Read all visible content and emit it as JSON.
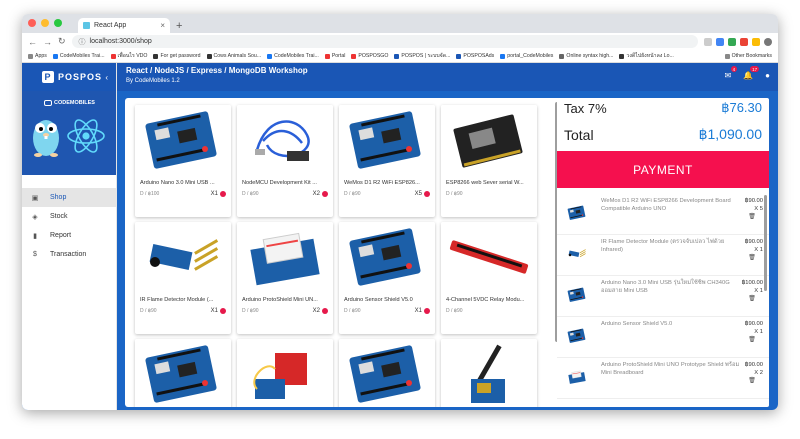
{
  "browser": {
    "tab_title": "React App",
    "url": "localhost:3000/shop",
    "bookmarks": [
      "Apps",
      "CodeMobiles Trai...",
      "เพื่อนไร VDO",
      "For get password",
      "Cows Animals Sou...",
      "CodeMobiles Trai...",
      "Portal",
      "POSPOSGO",
      "POSPOS | ระบบจัด...",
      "POSPOSAds",
      "portal_CodeMobiles",
      "Online syntax high...",
      "วงดีไปยังหน้าลง Lo..."
    ],
    "other_bookmarks": "Other Bookmarks"
  },
  "brand": {
    "name": "POSPOS",
    "logo_letter": "P",
    "company": "CODEMOBILES"
  },
  "header": {
    "title": "React / NodeJS / Express / MongoDB Workshop",
    "subtitle": "By CodeMobiles 1.2",
    "mail_badge": "4",
    "notif_badge": "17"
  },
  "nav": [
    {
      "label": "Shop",
      "icon": "shop-icon",
      "active": true
    },
    {
      "label": "Stock",
      "icon": "layers-icon",
      "active": false
    },
    {
      "label": "Report",
      "icon": "bar-chart-icon",
      "active": false
    },
    {
      "label": "Transaction",
      "icon": "dollar-icon",
      "active": false
    }
  ],
  "products": [
    {
      "name": "Arduino Nano 3.0 Mini USB ...",
      "price": "D / ฿100",
      "qty": "X1",
      "theme": "board-blue"
    },
    {
      "name": "NodeMCU Development Kit ...",
      "price": "D / ฿90",
      "qty": "X2",
      "theme": "cable"
    },
    {
      "name": "WeMos D1 R2 WiFi ESP826...",
      "price": "D / ฿90",
      "qty": "X5",
      "theme": "board-blue"
    },
    {
      "name": "ESP8266 web Sever serial W...",
      "price": "D / ฿90",
      "qty": "",
      "theme": "board-black"
    },
    {
      "name": "IR Flame Detector Module (...",
      "price": "D / ฿90",
      "qty": "X1",
      "theme": "sensor"
    },
    {
      "name": "Arduino ProtoShield Mini UN...",
      "price": "D / ฿90",
      "qty": "X2",
      "theme": "proto"
    },
    {
      "name": "Arduino Sensor Shield V5.0",
      "price": "D / ฿90",
      "qty": "X1",
      "theme": "board-blue"
    },
    {
      "name": "4-Channel 5VDC Relay Modu...",
      "price": "D / ฿90",
      "qty": "",
      "theme": "strip"
    },
    {
      "name": "",
      "price": "",
      "qty": "",
      "theme": "board-blue"
    },
    {
      "name": "",
      "price": "",
      "qty": "",
      "theme": "matrix"
    },
    {
      "name": "",
      "price": "",
      "qty": "",
      "theme": "board-blue"
    },
    {
      "name": "",
      "price": "",
      "qty": "",
      "theme": "antenna"
    }
  ],
  "summary": {
    "tax_label": "Tax 7%",
    "tax_value": "฿76.30",
    "total_label": "Total",
    "total_value": "฿1,090.00"
  },
  "payment_label": "PAYMENT",
  "cart": [
    {
      "name": "WeMos D1 R2 WiFi ESP8266 Development Board Compatible Arduino UNO",
      "price": "฿90.00",
      "qty": "X 5",
      "theme": "board-blue"
    },
    {
      "name": "IR Flame Detector Module (ตรวจจับเปลว ไฟด้วย Infrared)",
      "price": "฿90.00",
      "qty": "X 1",
      "theme": "sensor"
    },
    {
      "name": "Arduino Nano 3.0 Mini USB รุ่นใหม่ใช้ชิพ CH340G ออมสาย Mini USB",
      "price": "฿100.00",
      "qty": "X 1",
      "theme": "board-blue"
    },
    {
      "name": "Arduino Sensor Shield V5.0",
      "price": "฿90.00",
      "qty": "X 1",
      "theme": "board-blue"
    },
    {
      "name": "Arduino ProtoShield Mini UNO Prototype Shield พร้อม Mini Breadboard",
      "price": "฿90.00",
      "qty": "X 2",
      "theme": "proto"
    }
  ],
  "colors": {
    "primary": "#1a56b5",
    "accent": "#f5104e",
    "price_blue": "#1a7bd6"
  }
}
